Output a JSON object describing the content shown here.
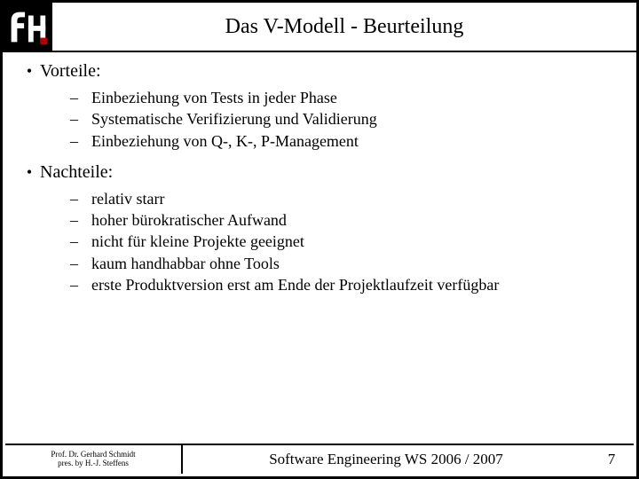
{
  "header": {
    "title": "Das V-Modell - Beurteilung"
  },
  "sections": [
    {
      "label": "Vorteile:",
      "items": [
        "Einbeziehung von Tests in jeder Phase",
        "Systematische Verifizierung und Validierung",
        "Einbeziehung von Q-, K-, P-Management"
      ]
    },
    {
      "label": "Nachteile:",
      "items": [
        "relativ starr",
        "hoher bürokratischer Aufwand",
        "nicht für kleine Projekte geeignet",
        "kaum handhabbar ohne Tools",
        "erste Produktversion erst am Ende der Projektlaufzeit verfügbar"
      ]
    }
  ],
  "footer": {
    "author_line1": "Prof. Dr. Gerhard Schmidt",
    "author_line2": "pres. by H.-J. Steffens",
    "center": "Software Engineering WS 2006 / 2007",
    "page": "7"
  }
}
